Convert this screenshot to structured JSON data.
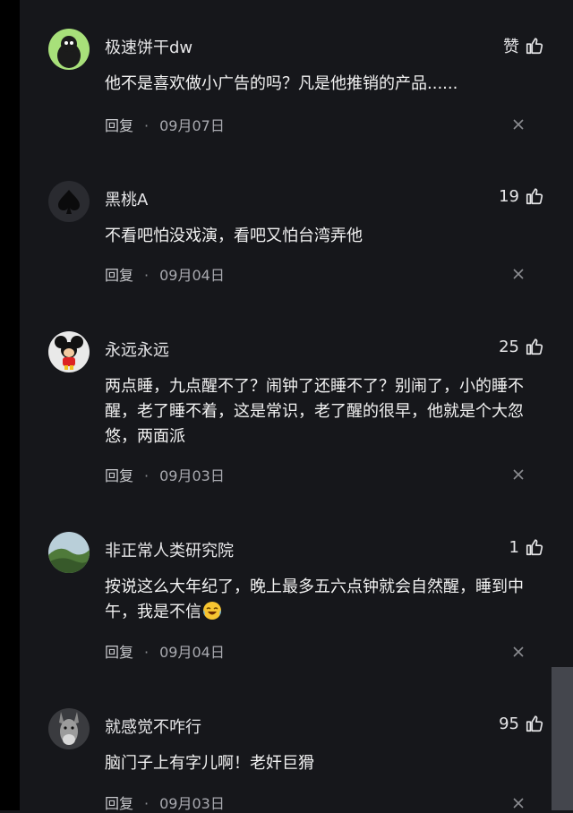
{
  "comments": [
    {
      "name": "极速饼干dw",
      "likes": "赞",
      "text": "他不是喜欢做小广告的吗？凡是他推销的产品......",
      "reply": "回复",
      "date": "09月07日",
      "avatar": "green-character-avatar"
    },
    {
      "name": "黑桃A",
      "likes": "19",
      "text": "不看吧怕没戏演，看吧又怕台湾弄他",
      "reply": "回复",
      "date": "09月04日",
      "avatar": "spade-avatar"
    },
    {
      "name": "永远永远",
      "likes": "25",
      "text": "两点睡，九点醒不了？闹钟了还睡不了？别闹了，小的睡不醒，老了睡不着，这是常识，老了醒的很早，他就是个大忽悠，两面派",
      "reply": "回复",
      "date": "09月03日",
      "avatar": "cartoon-mouse-avatar"
    },
    {
      "name": "非正常人类研究院",
      "likes": "1",
      "text": "按说这么大年纪了，晚上最多五六点钟就会自然醒，睡到中午，我是不信",
      "reply": "回复",
      "date": "09月04日",
      "avatar": "landscape-avatar",
      "emoji": "laughing-crying-emoji"
    },
    {
      "name": "就感觉不咋行",
      "likes": "95",
      "text": "脑门子上有字儿啊！老奸巨猾",
      "reply": "回复",
      "date": "09月03日",
      "avatar": "donkey-avatar"
    }
  ],
  "colors": {
    "background": "#16171b",
    "text": "#f2f2f2",
    "muted": "#a9aab0"
  }
}
